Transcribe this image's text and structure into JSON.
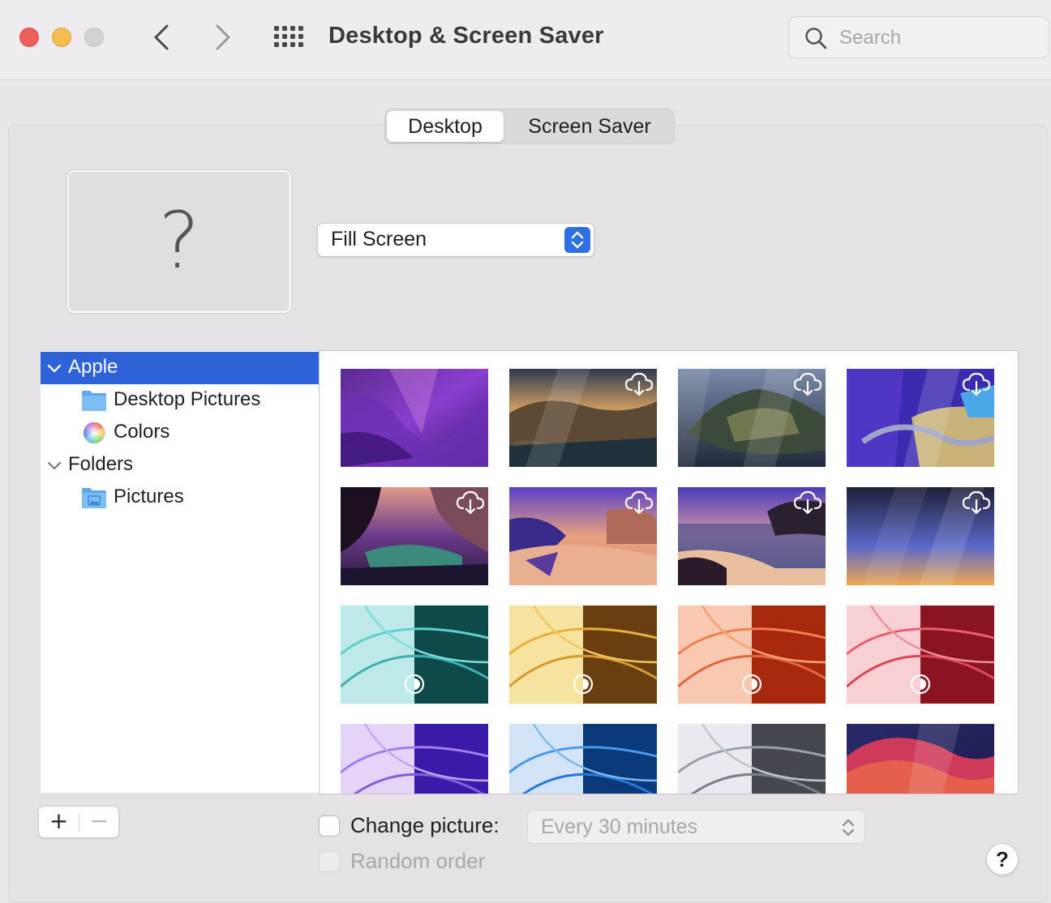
{
  "window": {
    "title": "Desktop & Screen Saver",
    "search_placeholder": "Search"
  },
  "tabs": [
    {
      "label": "Desktop",
      "selected": true
    },
    {
      "label": "Screen Saver",
      "selected": false
    }
  ],
  "preview": {
    "placeholder_glyph": "?"
  },
  "fit_mode": {
    "selected": "Fill Screen"
  },
  "sidebar": {
    "groups": [
      {
        "label": "Apple",
        "expanded": true,
        "selected": true,
        "items": [
          {
            "label": "Desktop Pictures",
            "icon": "folder-icon"
          },
          {
            "label": "Colors",
            "icon": "color-wheel-icon"
          }
        ]
      },
      {
        "label": "Folders",
        "expanded": true,
        "selected": false,
        "items": [
          {
            "label": "Pictures",
            "icon": "pictures-folder-icon"
          }
        ]
      }
    ]
  },
  "wallpapers": [
    {
      "name": "monterey",
      "badge": "none"
    },
    {
      "name": "catalina-sunset",
      "badge": "download"
    },
    {
      "name": "catalina-island",
      "badge": "download"
    },
    {
      "name": "big-sur-road",
      "badge": "download"
    },
    {
      "name": "lake-valley",
      "badge": "download"
    },
    {
      "name": "desert-hills",
      "badge": "download"
    },
    {
      "name": "coastline",
      "badge": "download"
    },
    {
      "name": "gradient-dusk",
      "badge": "download"
    },
    {
      "name": "imac-green",
      "badge": "dynamic"
    },
    {
      "name": "imac-yellow",
      "badge": "dynamic"
    },
    {
      "name": "imac-orange",
      "badge": "dynamic"
    },
    {
      "name": "imac-pink",
      "badge": "dynamic"
    },
    {
      "name": "imac-purple",
      "badge": "dynamic"
    },
    {
      "name": "imac-blue",
      "badge": "dynamic"
    },
    {
      "name": "imac-silver",
      "badge": "dynamic"
    },
    {
      "name": "big-sur-dynamic",
      "badge": "dynamic"
    }
  ],
  "controls": {
    "add": "+",
    "remove": "−",
    "change_picture_label": "Change picture:",
    "change_picture_checked": false,
    "interval": "Every 30 minutes",
    "random_order_label": "Random order",
    "random_order_checked": false,
    "help": "?"
  },
  "colors": {
    "selection": "#2e62d9",
    "accent": "#2e6fe6"
  }
}
